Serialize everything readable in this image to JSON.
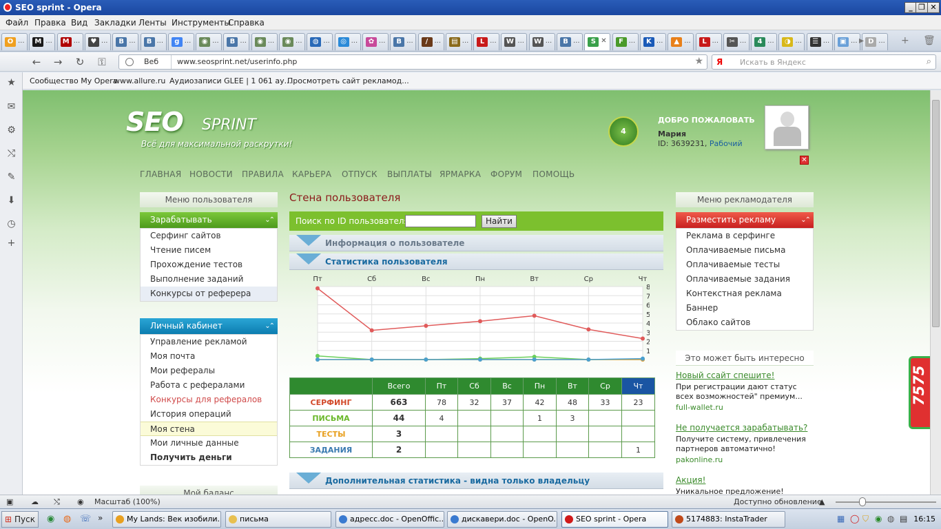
{
  "window": {
    "title": "SEO sprint - Opera"
  },
  "menubar": [
    "Файл",
    "Правка",
    "Вид",
    "Закладки",
    "Ленты",
    "Инструменты",
    "Справка"
  ],
  "tabs": [
    {
      "glyph": "O",
      "color": "#f0a020"
    },
    {
      "glyph": "M",
      "color": "#1a1a1a"
    },
    {
      "glyph": "M",
      "color": "#b00000"
    },
    {
      "glyph": "♥",
      "color": "#444"
    },
    {
      "glyph": "B",
      "color": "#4a76a8"
    },
    {
      "glyph": "B",
      "color": "#4a76a8"
    },
    {
      "glyph": "g",
      "color": "#4285f4"
    },
    {
      "glyph": "◉",
      "color": "#6a8a5a"
    },
    {
      "glyph": "B",
      "color": "#4a76a8"
    },
    {
      "glyph": "◉",
      "color": "#6a8a5a"
    },
    {
      "glyph": "◉",
      "color": "#6a8a5a"
    },
    {
      "glyph": "◍",
      "color": "#2a6ab8"
    },
    {
      "glyph": "◎",
      "color": "#2a8ad8"
    },
    {
      "glyph": "✿",
      "color": "#c84a9a"
    },
    {
      "glyph": "B",
      "color": "#4a76a8"
    },
    {
      "glyph": "/",
      "color": "#6a3a1a"
    },
    {
      "glyph": "▤",
      "color": "#8a6a1a"
    },
    {
      "glyph": "L",
      "color": "#c81a1a"
    },
    {
      "glyph": "W",
      "color": "#555"
    },
    {
      "glyph": "W",
      "color": "#555"
    },
    {
      "glyph": "B",
      "color": "#4a76a8"
    },
    {
      "glyph": "S",
      "color": "#3aa04a"
    },
    {
      "glyph": "F",
      "color": "#4a9a2a"
    },
    {
      "glyph": "K",
      "color": "#1a5ab8"
    },
    {
      "glyph": "▲",
      "color": "#e8801a"
    },
    {
      "glyph": "L",
      "color": "#c81a1a"
    },
    {
      "glyph": "✂",
      "color": "#555"
    },
    {
      "glyph": "4",
      "color": "#2a8a5a"
    },
    {
      "glyph": "◑",
      "color": "#d8b81a"
    },
    {
      "glyph": "☰",
      "color": "#333"
    },
    {
      "glyph": "▣",
      "color": "#6aa0d8"
    },
    {
      "glyph": "D",
      "color": "#aaa"
    }
  ],
  "address": {
    "prefix": "Веб",
    "url": "www.seosprint.net/userinfo.php",
    "search_placeholder": "Искать в Яндекс",
    "search_engine": "Я"
  },
  "bookmarks": [
    "Сообщество My Opera",
    "www.allure.ru",
    "Аудиозаписи GLEE | 1 061 ау...",
    "Просмотреть сайт рекламод..."
  ],
  "site": {
    "logo_main": "SEO",
    "logo_sub": "SPRINT",
    "tagline": "Всё для максимальной раскрутки!",
    "medal_level": "4",
    "welcome": "ДОБРО ПОЖАЛОВАТЬ",
    "user_name": "Мария",
    "user_id": "ID: 3639231,",
    "user_status": "Рабочий",
    "nav": [
      "ГЛАВНАЯ",
      "НОВОСТИ",
      "ПРАВИЛА",
      "КАРЬЕРА",
      "ОТПУСК",
      "ВЫПЛАТЫ",
      "ЯРМАРКА",
      "ФОРУМ",
      "ПОМОЩЬ"
    ]
  },
  "left": {
    "user_menu_head": "Меню пользователя",
    "earn_head": "Зарабатывать",
    "earn_items": [
      "Серфинг сайтов",
      "Чтение писем",
      "Прохождение тестов",
      "Выполнение заданий",
      "Конкурсы от реферера"
    ],
    "cabinet_head": "Личный кабинет",
    "cabinet_items": [
      "Управление рекламой",
      "Моя почта",
      "Мои рефералы",
      "Работа с рефералами",
      "Конкурсы для рефералов",
      "История операций",
      "Моя стена",
      "Мои личные данные",
      "Получить деньги"
    ],
    "balance_head": "Мой баланс"
  },
  "main": {
    "wall_title": "Стена пользователя",
    "search_label": "Поиск по ID пользователя:",
    "search_button": "Найти",
    "search_value": "",
    "section_info": "Информация о пользователе",
    "section_stats": "Статистика пользователя",
    "section_extra": "Дополнительная статистика - видна только владельцу"
  },
  "chart_data": {
    "type": "line",
    "categories": [
      "Пт",
      "Сб",
      "Вс",
      "Пн",
      "Вт",
      "Ср",
      "Чт"
    ],
    "ylim": [
      0,
      80
    ],
    "yticks": [
      10,
      20,
      30,
      40,
      50,
      60,
      70,
      80
    ],
    "series": [
      {
        "color": "#e05a5a",
        "values": [
          78,
          32,
          37,
          42,
          48,
          33,
          23
        ]
      },
      {
        "color": "#6acf5a",
        "values": [
          4,
          0,
          0,
          1,
          3,
          0,
          0
        ]
      },
      {
        "color": "#e8a040",
        "values": [
          0,
          0,
          0,
          0,
          0,
          0,
          0
        ]
      },
      {
        "color": "#4aa0d0",
        "values": [
          0,
          0,
          0,
          0,
          0,
          0,
          1
        ]
      }
    ]
  },
  "stats_table": {
    "headers": [
      "",
      "Всего",
      "Пт",
      "Сб",
      "Вс",
      "Пн",
      "Вт",
      "Ср",
      "Чт"
    ],
    "rows": [
      {
        "label": "СЕРФИНГ",
        "color": "#d24a2a",
        "cells": [
          "663",
          "78",
          "32",
          "37",
          "42",
          "48",
          "33",
          "23"
        ]
      },
      {
        "label": "ПИСЬМА",
        "color": "#6ab82a",
        "cells": [
          "44",
          "4",
          "",
          "",
          "1",
          "3",
          "",
          ""
        ]
      },
      {
        "label": "ТЕСТЫ",
        "color": "#e8a020",
        "cells": [
          "3",
          "",
          "",
          "",
          "",
          "",
          "",
          ""
        ]
      },
      {
        "label": "ЗАДАНИЯ",
        "color": "#3a7ab0",
        "cells": [
          "2",
          "",
          "",
          "",
          "",
          "",
          "",
          "1"
        ]
      }
    ]
  },
  "right": {
    "adv_menu_head": "Меню рекламодателя",
    "place_ad_head": "Разместить рекламу",
    "adv_items": [
      "Реклама в серфинге",
      "Оплачиваемые письма",
      "Оплачиваемые тесты",
      "Оплачиваемые задания",
      "Контекстная реклама",
      "Баннер",
      "Облако сайтов"
    ],
    "interest_head": "Это может быть интересно",
    "ads": [
      {
        "title": "Новый ссайт спешите!",
        "text": "При регистрации дают статус всех возможностей\" премиум...",
        "link": "full-wallet.ru"
      },
      {
        "title": "Не получается зарабатывать?",
        "text": "Получите систему, привлечения партнеров автоматично!",
        "link": "pakonline.ru"
      },
      {
        "title": "Акция!",
        "text": "Уникальное предложение!",
        "link": ""
      }
    ],
    "side_badge": "7575"
  },
  "statusbar": {
    "zoom": "Масштаб (100%)",
    "update": "Доступно обновление"
  },
  "taskbar": {
    "start": "Пуск",
    "tasks": [
      {
        "label": "My Lands: Век изобили...",
        "color": "#e8a020"
      },
      {
        "label": "письма",
        "color": "#e8c050"
      },
      {
        "label": "адресс.doc - OpenOffic...",
        "color": "#3a7ad0"
      },
      {
        "label": "дискавери.doc - OpenO...",
        "color": "#3a7ad0"
      },
      {
        "label": "SEO sprint - Opera",
        "color": "#d01a1a"
      },
      {
        "label": "5174883: InstaTrader",
        "color": "#c04a1a"
      }
    ],
    "clock": "16:15"
  }
}
